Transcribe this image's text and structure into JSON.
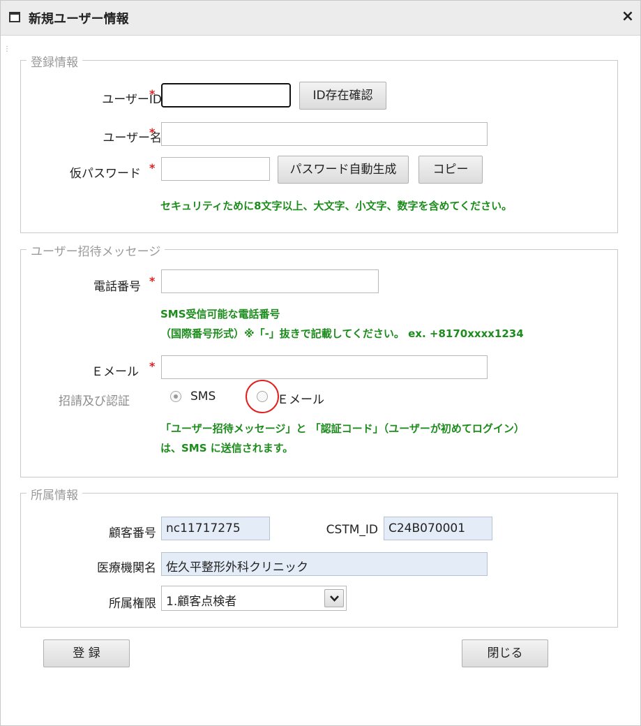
{
  "window": {
    "title": "新規ユーザー情報",
    "close": "×"
  },
  "registration": {
    "legend": "登録情報",
    "user_id_label": "ユーザーID",
    "user_id_value": "",
    "id_check_button": "ID存在確認",
    "user_name_label": "ユーザー名",
    "user_name_value": "",
    "temp_password_label": "仮パスワード",
    "temp_password_value": "",
    "auto_generate_button": "パスワード自動生成",
    "copy_button": "コピー",
    "password_note": "セキュリティために8文字以上、大文字、小文字、数字を含めてください。",
    "required_mark": "*"
  },
  "invitation": {
    "legend": "ユーザー招待メッセージ",
    "phone_label": "電話番号",
    "phone_value": "",
    "phone_note_line1": "SMS受信可能な電話番号",
    "phone_note_line2": "（国際番号形式）※「-」抜きで記載してください。 ex. +8170xxxx1234",
    "email_label": "Ｅメール",
    "email_value": "",
    "auth_label": "招請及び認証",
    "radio_sms": "SMS",
    "radio_email": "Ｅメール",
    "selected": "SMS",
    "send_note_line1": "「ユーザー招待メッセージ」と 「認証コード」（ユーザーが初めてログイン）",
    "send_note_line2": "は、SMS に送信されます。"
  },
  "affiliation": {
    "legend": "所属情報",
    "customer_no_label": "顧客番号",
    "customer_no_value": "nc11717275",
    "cstm_id_label": "CSTM_ID",
    "cstm_id_value": "C24B070001",
    "institution_label": "医療機関名",
    "institution_value": "佐久平整形外科クリニック",
    "role_label": "所属権限",
    "role_value": "1.顧客点検者"
  },
  "footer": {
    "register_button": "登 録",
    "close_button": "閉じる"
  },
  "colors": {
    "required": "#e02020",
    "note": "#1d8c1d",
    "readonly_bg": "#e4edf7",
    "highlight_circle": "#e02020"
  }
}
